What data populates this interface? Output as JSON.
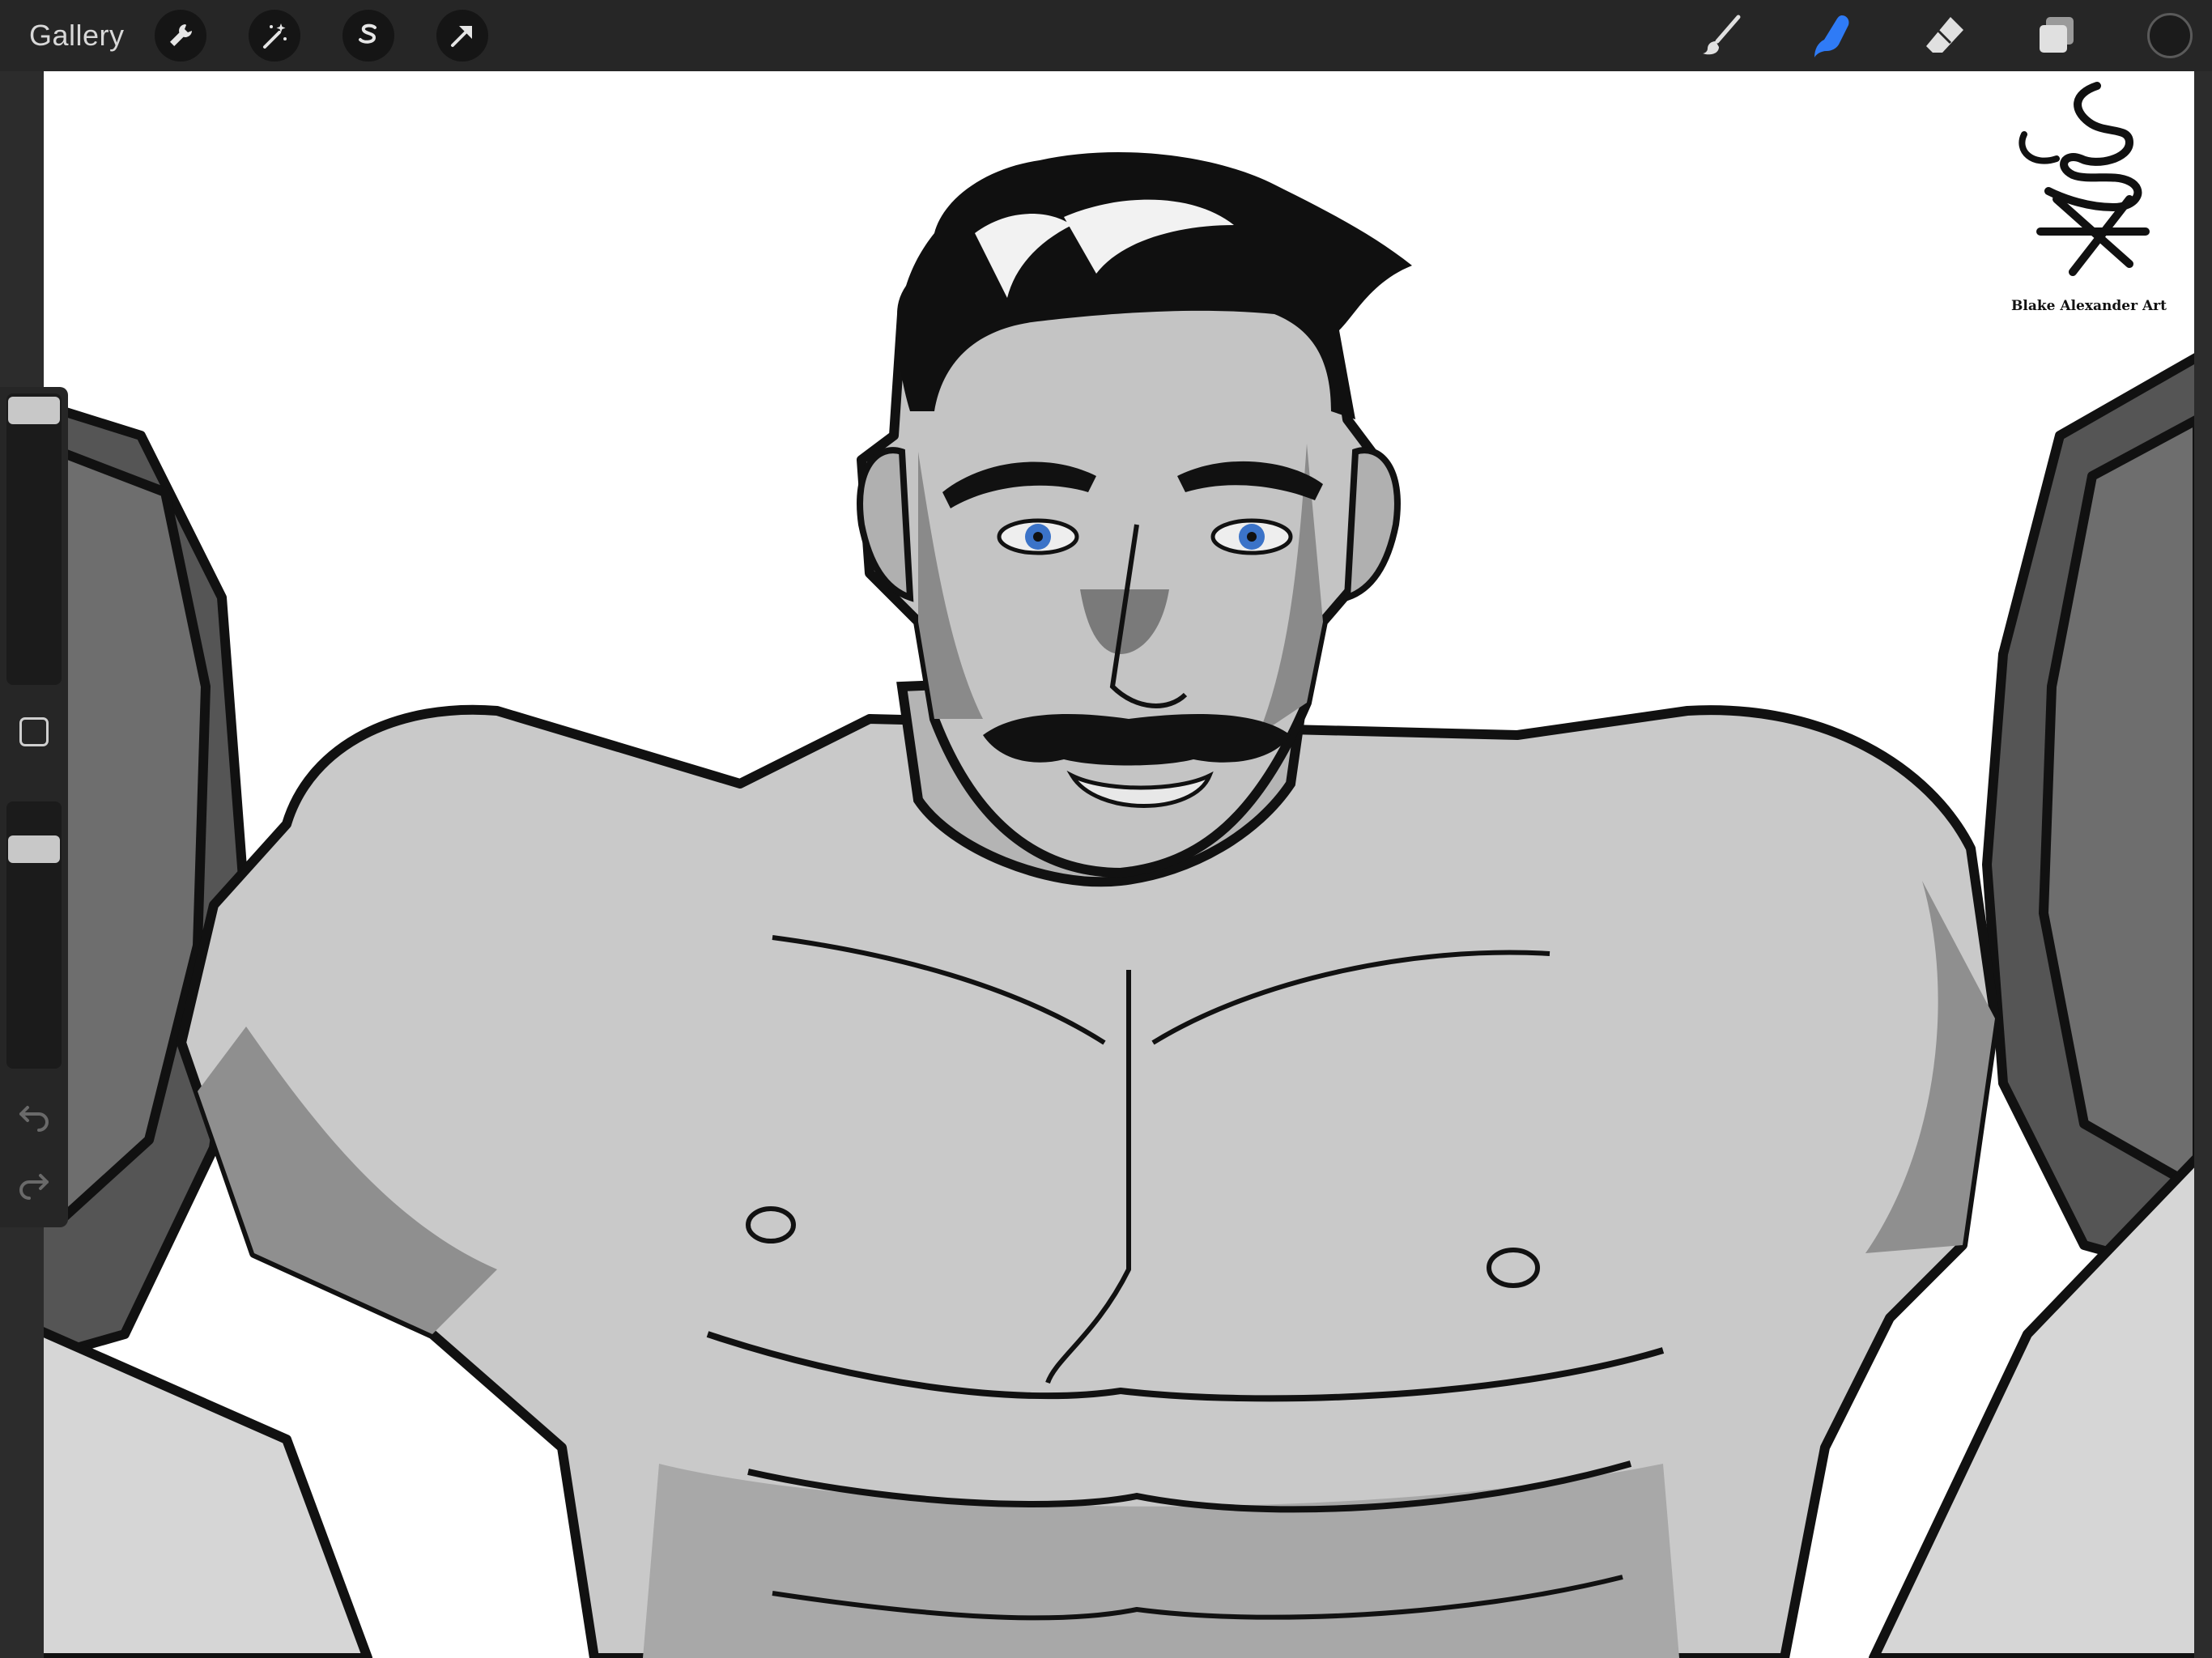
{
  "app": "Procreate",
  "toolbar": {
    "gallery_label": "Gallery",
    "left_tools": [
      "wrench-icon",
      "magic-wand-icon",
      "selection-s-icon",
      "arrow-transform-icon"
    ],
    "right_tools": [
      "brush-icon",
      "smudge-icon",
      "eraser-icon",
      "layers-icon"
    ],
    "active_tool": "smudge",
    "active_color": "#2f7bf6",
    "current_color": "#1b1b1b"
  },
  "sidebar": {
    "brush_size_level": 0.02,
    "opacity_level": 0.2,
    "modify_button": "square-icon",
    "undo": "undo-icon",
    "redo": "redo-icon"
  },
  "canvas": {
    "signature_text": "Blake Alexander Art",
    "signature": "BA monogram logo",
    "eye_color": "#3b73c8"
  }
}
